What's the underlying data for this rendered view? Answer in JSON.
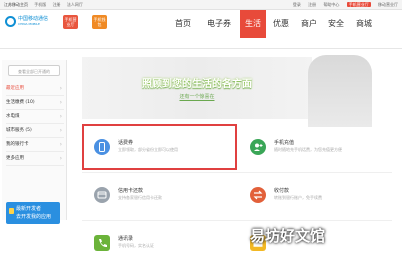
{
  "topbar": {
    "brand": "江苏移动主页",
    "links_left": [
      "手机版",
      "注册",
      "法人网厅"
    ],
    "links_right": [
      "登录",
      "注册",
      "帮助中心",
      "手机营业厅",
      "移动营业厅"
    ]
  },
  "header": {
    "logo_title": "中国移动通信",
    "logo_subtitle": "CHINA MOBILE",
    "tags": [
      "手机营业厅",
      "手机钱包"
    ]
  },
  "nav": {
    "items": [
      "首页",
      "电子券",
      "生活",
      "优惠",
      "商户",
      "安全",
      "商城"
    ],
    "active_index": 2
  },
  "sidebar": {
    "search_placeholder": "查看全部已开通的",
    "items": [
      "最近应用",
      "生活缴费 (10)",
      "水电煤",
      "城市服务 (5)",
      "我的银行卡",
      "更多应用"
    ],
    "active_index": 0,
    "promo_line1": "最新开发者",
    "promo_line2": "去开发我的应用"
  },
  "banner": {
    "slogan": "照顾到您的生活的各方面",
    "sub": "还有一个惊喜在"
  },
  "cards": [
    {
      "title": "话费券",
      "desc": "立即领取，部分省份立即可以使用",
      "icon": "phone-card-icon",
      "color": "#4a90e2"
    },
    {
      "title": "手机充值",
      "desc": "随时随地充手机话费，为您充值更方便",
      "icon": "user-plus-icon",
      "color": "#3aa657"
    },
    {
      "title": "信用卡还款",
      "desc": "支持各家银行信用卡还款",
      "icon": "credit-card-icon",
      "color": "#9aa3ad"
    },
    {
      "title": "收付款",
      "desc": "转账到银行账户，免手续费",
      "icon": "transfer-icon",
      "color": "#e2603a"
    },
    {
      "title": "通讯录",
      "desc": "手机号码，实名认证",
      "icon": "phone-icon",
      "color": "#6bb33a"
    },
    {
      "title": "",
      "desc": "",
      "icon": "folder-icon",
      "color": "#f2b824"
    }
  ],
  "watermark": "易坊好文馆"
}
